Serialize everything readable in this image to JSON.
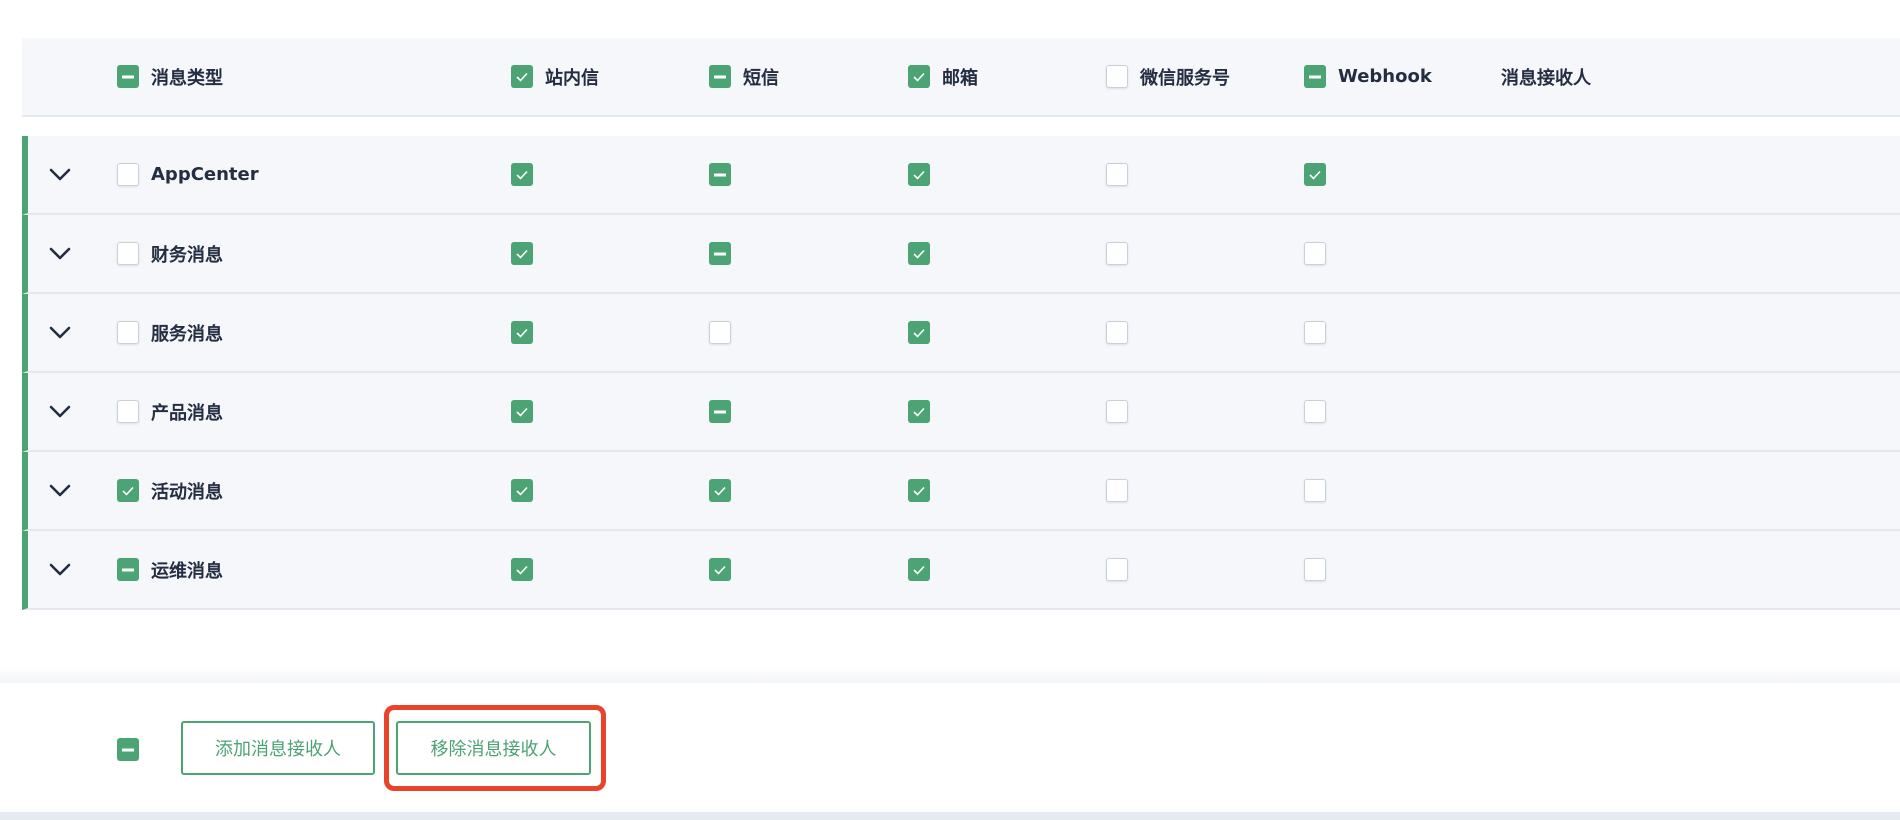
{
  "colors": {
    "accent": "#4ca373",
    "highlight": "#e8432b",
    "text": "#242e42"
  },
  "header": {
    "type_column": {
      "label": "消息类型",
      "state": "indeterminate"
    },
    "channels": [
      {
        "label": "站内信",
        "state": "checked"
      },
      {
        "label": "短信",
        "state": "indeterminate"
      },
      {
        "label": "邮箱",
        "state": "checked"
      },
      {
        "label": "微信服务号",
        "state": "unchecked"
      },
      {
        "label": "Webhook",
        "state": "indeterminate"
      }
    ],
    "recipients_label": "消息接收人"
  },
  "rows": [
    {
      "name": "AppCenter",
      "state": "unchecked",
      "channels": [
        "checked",
        "indeterminate",
        "checked",
        "unchecked",
        "checked"
      ]
    },
    {
      "name": "财务消息",
      "state": "unchecked",
      "channels": [
        "checked",
        "indeterminate",
        "checked",
        "unchecked",
        "unchecked"
      ]
    },
    {
      "name": "服务消息",
      "state": "unchecked",
      "channels": [
        "checked",
        "unchecked",
        "checked",
        "unchecked",
        "unchecked"
      ]
    },
    {
      "name": "产品消息",
      "state": "unchecked",
      "channels": [
        "checked",
        "indeterminate",
        "checked",
        "unchecked",
        "unchecked"
      ]
    },
    {
      "name": "活动消息",
      "state": "checked",
      "channels": [
        "checked",
        "checked",
        "checked",
        "unchecked",
        "unchecked"
      ]
    },
    {
      "name": "运维消息",
      "state": "indeterminate",
      "channels": [
        "checked",
        "checked",
        "checked",
        "unchecked",
        "unchecked"
      ]
    }
  ],
  "footer": {
    "select_state": "indeterminate",
    "add_recipient_label": "添加消息接收人",
    "remove_recipient_label": "移除消息接收人"
  }
}
